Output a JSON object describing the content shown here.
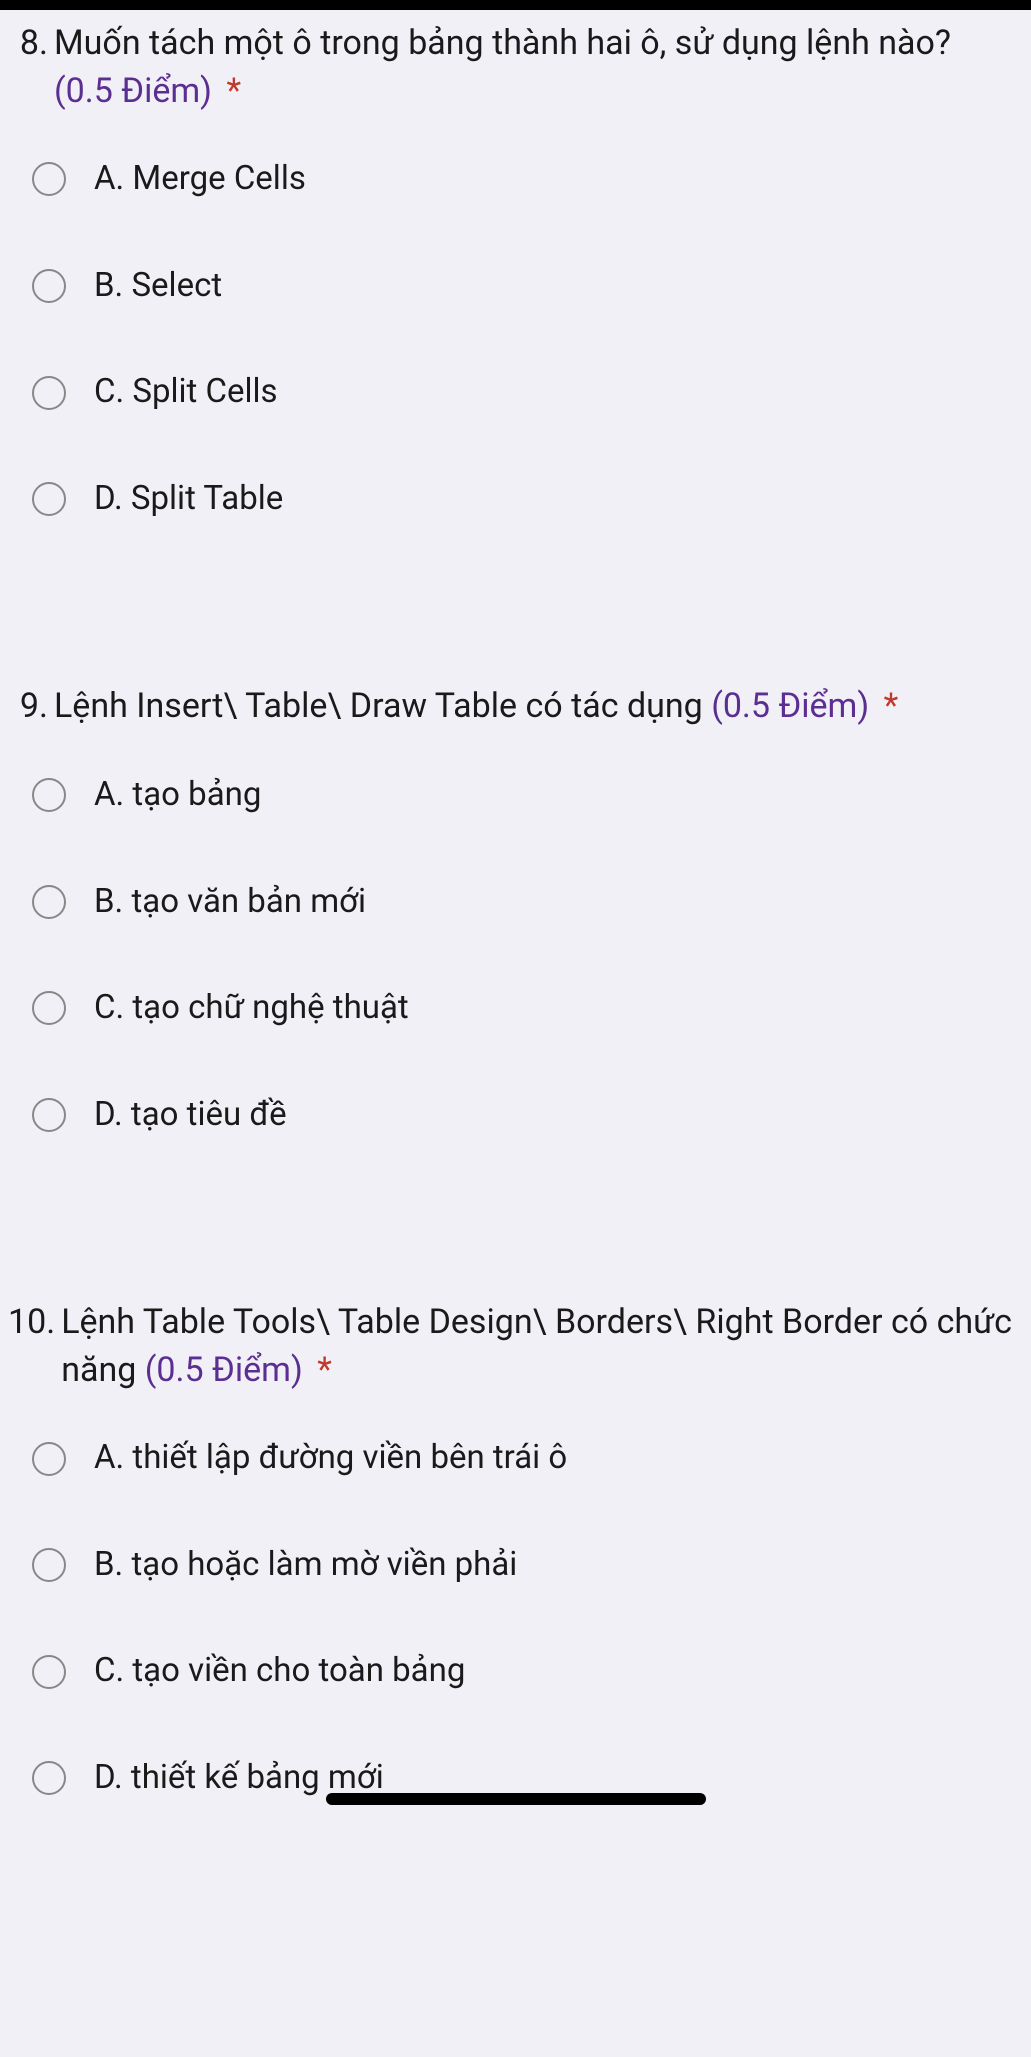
{
  "questions": [
    {
      "number": "8.",
      "text": "Muốn tách một ô trong bảng thành hai ô, sử dụng lệnh nào?",
      "points": "(0.5 Điểm)",
      "required": "*",
      "options": [
        "A. Merge Cells",
        "B. Select",
        "C. Split Cells",
        "D. Split Table"
      ]
    },
    {
      "number": "9.",
      "text": "Lệnh Insert\\ Table\\ Draw Table có tác dụng",
      "points": "(0.5 Điểm)",
      "required": "*",
      "options": [
        "A. tạo bảng",
        "B. tạo văn bản mới",
        "C. tạo chữ nghệ thuật",
        "D. tạo tiêu đề"
      ]
    },
    {
      "number": "10.",
      "text": "Lệnh Table Tools\\ Table Design\\ Borders\\ Right Border có chức năng",
      "points": "(0.5 Điểm)",
      "required": "*",
      "options": [
        "A. thiết lập đường viền bên trái ô",
        "B. tạo hoặc làm mờ viền phải",
        "C. tạo viền cho toàn bảng",
        "D. thiết kế bảng mới"
      ]
    }
  ]
}
